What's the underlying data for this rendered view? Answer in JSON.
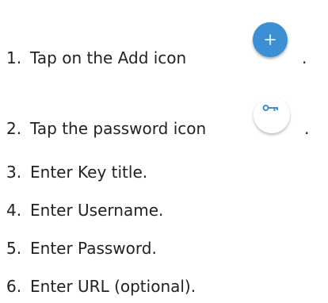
{
  "steps": [
    {
      "num": "1.",
      "text": "Tap on the Add icon",
      "trail": "."
    },
    {
      "num": "2.",
      "text": "Tap the password icon",
      "trail": "."
    },
    {
      "num": "3.",
      "text": "Enter Key title."
    },
    {
      "num": "4.",
      "text": "Enter Username."
    },
    {
      "num": "5.",
      "text": "Enter Password."
    },
    {
      "num": "6.",
      "text": "Enter URL (optional)."
    }
  ],
  "icons": {
    "add": {
      "name": "plus-icon",
      "color": "#3b8fd4"
    },
    "password": {
      "name": "key-icon",
      "color": "#3b8fd4"
    }
  }
}
